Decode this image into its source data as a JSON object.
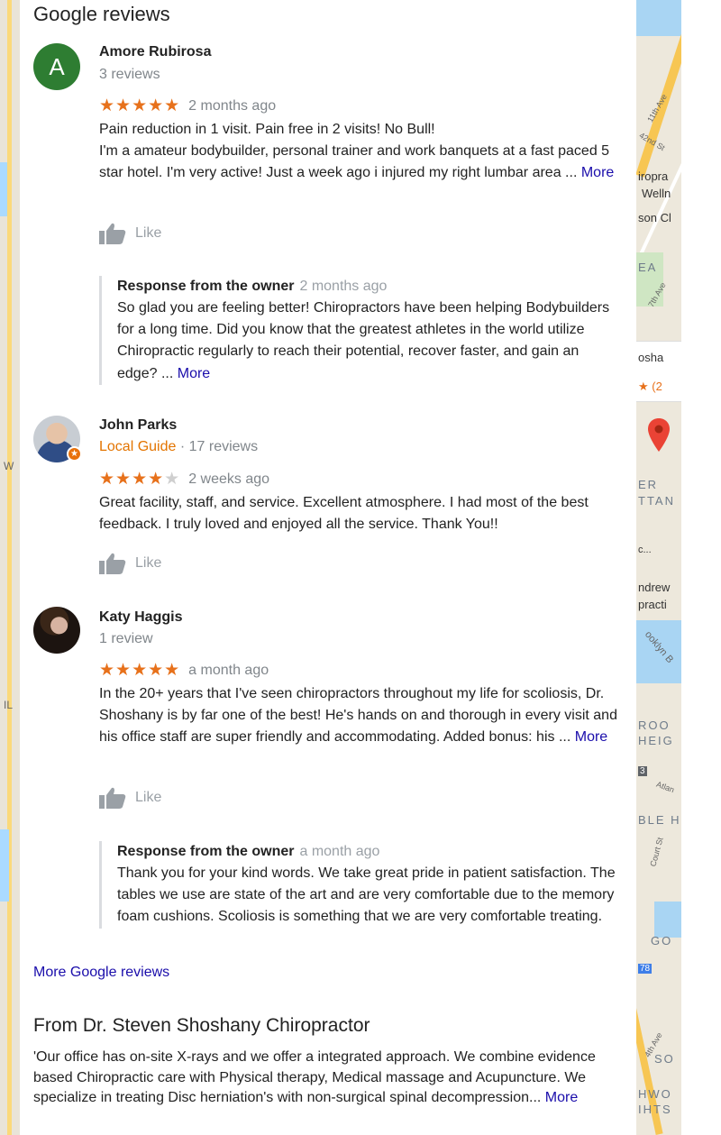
{
  "section_title": "Google reviews",
  "reviews": [
    {
      "avatar_letter": "A",
      "author": "Amore Rubirosa",
      "guide": "",
      "review_count": "3 reviews",
      "rating": 5,
      "stars_text": "★★★★★",
      "time": "2 months ago",
      "text": "Pain reduction in 1 visit. Pain free in 2 visits! No Bull!\nI'm a amateur bodybuilder, personal trainer and work banquets at a fast paced 5 star hotel. I'm very active!  Just a week ago i injured my right lumbar area ...",
      "more": "More",
      "like": "Like",
      "response": {
        "label": "Response from the owner",
        "time": "2 months ago",
        "text": "So glad you are feeling better! Chiropractors have been helping Bodybuilders for a long time. Did you know that the greatest athletes in the world utilize Chiropractic regularly to reach their potential, recover faster, and gain an edge? ...",
        "more": "More"
      }
    },
    {
      "author": "John Parks",
      "guide": "Local Guide",
      "review_count": "· 17 reviews",
      "rating": 4,
      "stars_on": "★★★★",
      "stars_off": "★",
      "time": "2 weeks ago",
      "text": "Great facility, staff, and service. Excellent atmosphere. I had most of the best feedback. I truly loved and enjoyed all the service. Thank You!!",
      "like": "Like"
    },
    {
      "author": "Katy Haggis",
      "guide": "",
      "review_count": "1 review",
      "rating": 5,
      "stars_text": "★★★★★",
      "time": "a month ago",
      "text": "In the 20+ years that I've seen chiropractors throughout my life for scoliosis, Dr. Shoshany is by far one of the best! He's hands on and thorough in every visit and his office staff are super friendly and accommodating. Added bonus: his ...",
      "more": "More",
      "like": "Like",
      "response": {
        "label": "Response from the owner",
        "time": "a month ago",
        "text": "Thank you for your kind words. We take great pride in patient satisfaction. The tables we use are state of the art and are very comfortable due to the memory foam cushions. Scoliosis is something that we are very comfortable treating."
      }
    }
  ],
  "more_reviews": "More Google reviews",
  "from_title": "From Dr. Steven Shoshany Chiropractor",
  "from_text": "'Our office has on-site X-rays and we offer a integrated approach. We combine evidence based Chiropractic care with Physical therapy, Medical massage and Acupuncture. We specialize in treating Disc herniation's with non-surgical spinal decompression...",
  "from_more": "More",
  "map": {
    "street_11th": "11th Ave",
    "street_42nd": "42nd St",
    "place_line1": "iropra",
    "place_line2": "Welln",
    "place_line3": "son Cl",
    "area_ea": "EA",
    "street_7th": "7th Ave",
    "card_name": "osha",
    "card_rating": "★ (2",
    "area_er": "ER",
    "area_ttan": "TTAN",
    "card_dots": "c...",
    "andrew_1": "ndrew",
    "andrew_2": "practi",
    "brooklyn_b": "ooklyn B",
    "area_broo": "ROO",
    "area_heig": "HEIG",
    "route_3": "3",
    "street_atlan": "Atlan",
    "area_ble": "BLE H",
    "street_court": "Court St",
    "area_go": "GO",
    "route_78": "78",
    "street_4th": "4th Ave",
    "area_so": "SO",
    "area_hwo": "HWO",
    "area_ihts": "IHTS",
    "left_w": "W",
    "left_il": "IL"
  }
}
